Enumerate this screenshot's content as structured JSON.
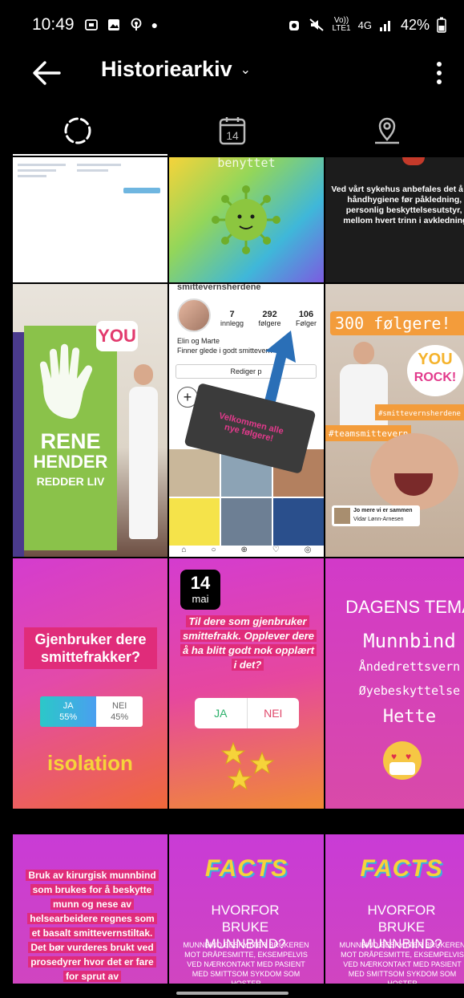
{
  "status_bar": {
    "time": "10:49",
    "net_top": "Vo))",
    "net_bottom": "LTE1",
    "net_type": "4G",
    "battery": "42%"
  },
  "header": {
    "title": "Historiearkiv",
    "title_chevron": "⌄"
  },
  "tabs": [
    {
      "name": "stories",
      "icon": "loading-circle-icon"
    },
    {
      "name": "calendar",
      "icon": "calendar-icon",
      "label": "14"
    },
    {
      "name": "map",
      "icon": "location-pin-icon"
    }
  ],
  "stories": {
    "s1_note": "",
    "s2_top_text": "benyttet",
    "s3_text": "Ved vårt sykehus anbefales det å utføre håndhygiene før påkledning, av personlig beskyttelsesutstyr, og mellom hvert trinn i avkledningen",
    "s4_banner_lines": [
      "RENE",
      "HENDER",
      "REDDER LIV"
    ],
    "s4_sticker": "YOU",
    "s5_profile_header": "smittevernsherdene",
    "s5_posts": "7",
    "s5_posts_label": "innlegg",
    "s5_followers": "292",
    "s5_followers_label": "følgere",
    "s5_following": "106",
    "s5_following_label": "Følger",
    "s5_bio_name": "Elin og Marte",
    "s5_bio_text": "Finner glede i godt smittevern",
    "s5_edit": "Rediger p",
    "s5_flag_text": "Velkommen alle nye følgere!",
    "s6_banner": "300 følgere!",
    "s6_sticker_1": "YOU",
    "s6_sticker_2": "ROCK!",
    "s6_tag_1": "#smittevernsherdene",
    "s6_tag_2": "#teamsmittevern",
    "s6_card_title": "Jo mere vi er sammen",
    "s6_card_sub": "Vidar Lønn-Arnesen",
    "s7_question": "Gjenbruker dere smittefrakker?",
    "s7_opt_yes": "JA",
    "s7_opt_yes_pct": "55%",
    "s7_opt_no": "NEI",
    "s7_opt_no_pct": "45%",
    "s7_yes_share": 0.55,
    "s7_logo": "isolation",
    "s8_date_day": "14",
    "s8_date_month": "mai",
    "s8_question": "Til dere som gjenbruker smittefrakk. Opplever dere å ha blitt godt nok opplært i det?",
    "s8_opt_yes": "JA",
    "s8_opt_no": "NEI",
    "s9_title": "DAGENS TEMA",
    "s9_items": [
      "Munnbind",
      "Åndedrettsvern",
      "Øyebeskyttelse",
      "Hette"
    ],
    "s10_text": "Bruk av kirurgisk munnbind som brukes for å beskytte munn og nese av helsearbeidere regnes som et basalt smittevernstiltak. Det bør vurderes brukt ved prosedyrer hvor det er fare for sprut av",
    "s11_facts": "FACTS",
    "s11_title": "HVORFOR BRUKE MUNNBIND?",
    "s11_body": "MUNNBIND BESKYTTER BRUKEREN MOT DRÅPESMITTE, EKSEMPELVIS VED NÆRKONTAKT MED PASIENT MED SMITTSOM SYKDOM SOM HOSTER",
    "s12_facts": "FACTS",
    "s12_title": "HVORFOR BRUKE MUNNBIND?",
    "s12_body": "MUNNBIND BESKYTTER BRUKEREN MOT DRÅPESMITTE, EKSEMPELVIS VED NÆRKONTAKT MED PASIENT MED SMITTSOM SYKDOM SOM HOSTER"
  }
}
